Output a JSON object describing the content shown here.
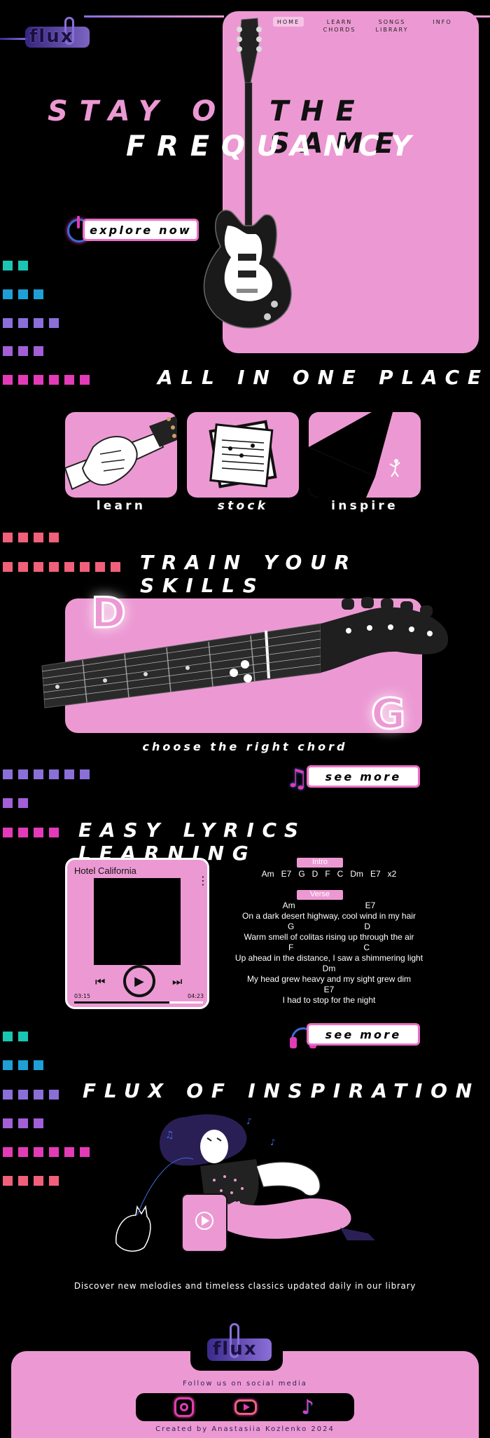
{
  "brand": {
    "logo_text": "flux"
  },
  "nav": [
    {
      "label": "HOME"
    },
    {
      "label": "LEARN CHORDS"
    },
    {
      "label": "SONGS LIBRARY"
    },
    {
      "label": "INFO"
    }
  ],
  "hero": {
    "line1a": "STAY ON",
    "line1b": "THE SAME",
    "line2": "FREQUANCY",
    "cta": "explore now"
  },
  "features": {
    "heading": "ALL IN ONE PLACE",
    "items": [
      {
        "label": "learn"
      },
      {
        "label": "stock"
      },
      {
        "label": "inspire"
      }
    ]
  },
  "train": {
    "heading": "TRAIN YOUR SKILLS",
    "chord_left": "D",
    "chord_right": "G",
    "caption": "choose the right chord",
    "cta": "see more"
  },
  "lyrics": {
    "heading": "EASY LYRICS LEARNING",
    "player": {
      "title": "Hotel California",
      "time_current": "03:15",
      "time_total": "04:23",
      "progress": 0.74
    },
    "intro_label": "Intro",
    "intro_chords": "Am   E7   G   D   F   C   Dm   E7   x2",
    "verse_label": "Verse",
    "lines": [
      {
        "chords": "Am                              E7",
        "text": "On a dark desert highway, cool wind in my hair"
      },
      {
        "chords": "G                              D",
        "text": "Warm smell of colitas rising up through the air"
      },
      {
        "chords": "F                              C",
        "text": "Up ahead in the distance, I saw a shimmering light"
      },
      {
        "chords": "Dm",
        "text": "My head grew heavy and my sight grew dim"
      },
      {
        "chords": "E7",
        "text": "I had to stop for the night"
      }
    ],
    "cta": "see more"
  },
  "inspiration": {
    "heading": "FLUX OF INSPIRATION",
    "tagline": "Discover new melodies and timeless classics updated daily in our library"
  },
  "footer": {
    "follow": "Follow us on social media",
    "credit": "Created by Anastasiia Kozlenko 2024",
    "socials": [
      {
        "icon": "instagram-icon"
      },
      {
        "icon": "youtube-icon"
      },
      {
        "icon": "tiktok-icon"
      }
    ]
  },
  "colors": {
    "pink": "#ec99d3",
    "teal": "#19c6b4",
    "blue": "#1e9fd6",
    "violet": "#8a6fd8",
    "purple": "#a35fd6",
    "magenta": "#e33bb8",
    "coral": "#f0607a"
  }
}
